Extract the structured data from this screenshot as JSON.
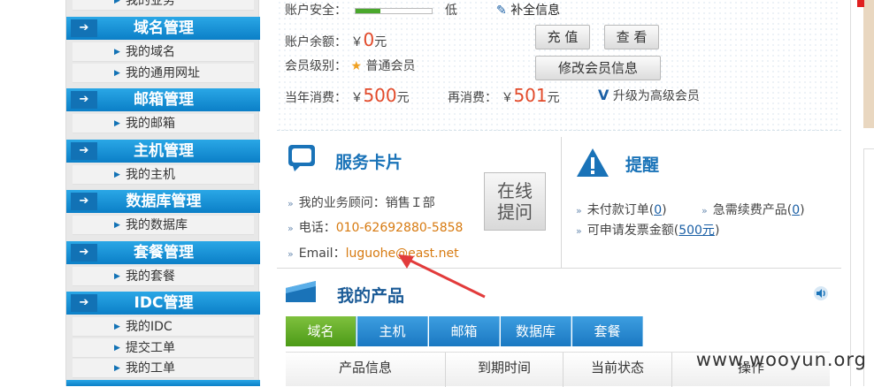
{
  "sidebar": {
    "top_partial": "我的业务",
    "categories": [
      {
        "title": "域名管理",
        "items": [
          "我的域名",
          "我的通用网址"
        ]
      },
      {
        "title": "邮箱管理",
        "items": [
          "我的邮箱"
        ]
      },
      {
        "title": "主机管理",
        "items": [
          "我的主机"
        ]
      },
      {
        "title": "数据库管理",
        "items": [
          "我的数据库"
        ]
      },
      {
        "title": "套餐管理",
        "items": [
          "我的套餐"
        ]
      },
      {
        "title": "IDC管理",
        "items": [
          "我的IDC",
          "提交工单",
          "我的工单"
        ]
      }
    ],
    "arrow_glyph": "➔"
  },
  "account": {
    "security_label": "账户安全：",
    "security_level": "低",
    "security_level_value": 0.33,
    "complete_info_label": "补全信息",
    "balance_label": "账户余额：",
    "currency": "￥",
    "balance_value": "0",
    "unit": "元",
    "member_label": "会员级别：",
    "member_level": "普通会员",
    "yearly_label": "当年消费：",
    "yearly_value": "500",
    "more_label": "再消费：",
    "more_value": "501",
    "upgrade_label": "升级为高级会员",
    "recharge_button": "充 值",
    "view_button": "查 看",
    "edit_member_button": "修改会员信息"
  },
  "service_card": {
    "title": "服务卡片",
    "consultant_label": "我的业务顾问：",
    "consultant_value": "销售Ｉ部",
    "phone_label": "电话：",
    "phone_value": "010-62692880-5858",
    "email_label": "Email：",
    "email_value": "luguohe@east.net",
    "online_btn_line1": "在线",
    "online_btn_line2": "提问"
  },
  "reminder": {
    "title": "提醒",
    "unpaid_label": "未付款订单",
    "unpaid_count": "0",
    "renew_label": "急需续费产品",
    "renew_count": "0",
    "invoice_label": "可申请发票金额",
    "invoice_value": "500元"
  },
  "products": {
    "title": "我的产品",
    "tabs": [
      "域名",
      "主机",
      "邮箱",
      "数据库",
      "套餐"
    ],
    "active_tab": "域名",
    "columns": [
      "产品信息",
      "到期时间",
      "当前状态",
      "操作"
    ]
  },
  "watermark": "www.wooyun.org",
  "colors": {
    "accent_blue": "#1a73b8",
    "price_red": "#e24a2a",
    "link_orange": "#d77a10",
    "active_tab_green": "#5aa622",
    "annotation_arrow": "#e23b3b"
  }
}
